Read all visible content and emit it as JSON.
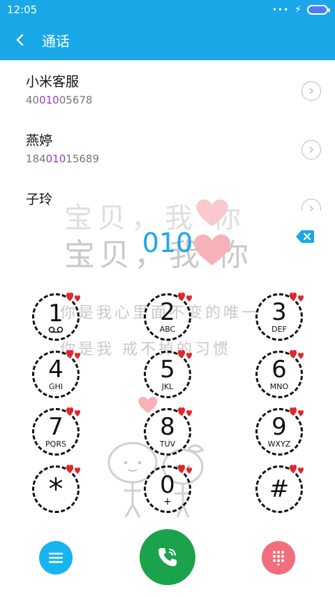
{
  "status": {
    "time": "12:05"
  },
  "header": {
    "title": "通话"
  },
  "results": [
    {
      "name": "小米客服",
      "number_pre": "40",
      "number_match": "010",
      "number_post": "05678"
    },
    {
      "name": "燕婷",
      "number_pre": "184",
      "number_match": "010",
      "number_post": "15689"
    },
    {
      "name": "子玲",
      "number_pre": "",
      "number_match": "",
      "number_post": ""
    }
  ],
  "dialer": {
    "input": "010",
    "keys": [
      {
        "digit": "1",
        "letters": ""
      },
      {
        "digit": "2",
        "letters": "ABC"
      },
      {
        "digit": "3",
        "letters": "DEF"
      },
      {
        "digit": "4",
        "letters": "GHI"
      },
      {
        "digit": "5",
        "letters": "JKL"
      },
      {
        "digit": "6",
        "letters": "MNO"
      },
      {
        "digit": "7",
        "letters": "PQRS"
      },
      {
        "digit": "8",
        "letters": "TUV"
      },
      {
        "digit": "9",
        "letters": "WXYZ"
      },
      {
        "digit": "*",
        "letters": ""
      },
      {
        "digit": "0",
        "letters": "+"
      },
      {
        "digit": "#",
        "letters": ""
      }
    ]
  },
  "wallpaper": {
    "line_top": "宝贝，我 你",
    "line_big": "宝贝，我 你",
    "line1": "你是我心里面不变的唯一",
    "line2": "你是我 戒不掉的习惯"
  },
  "colors": {
    "accent": "#1aa7e8",
    "match": "#9a38c8",
    "call": "#1aa34a",
    "menu": "#17b4f0",
    "pad": "#f26e7d",
    "heart": "#f7b2b8"
  }
}
